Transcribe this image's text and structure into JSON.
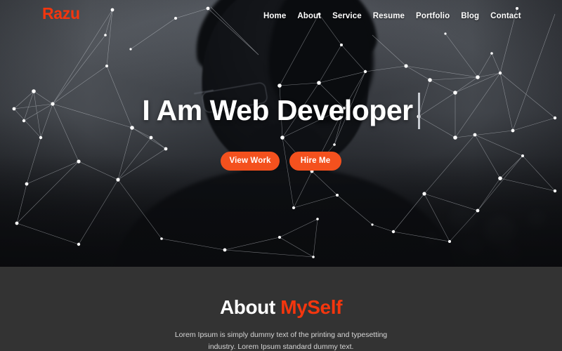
{
  "brand": {
    "logo_text": "Razu",
    "accent_color": "#f4360e",
    "button_color": "#f4511e"
  },
  "nav": {
    "items": [
      {
        "label": "Home"
      },
      {
        "label": "About"
      },
      {
        "label": "Service"
      },
      {
        "label": "Resume"
      },
      {
        "label": "Portfolio"
      },
      {
        "label": "Blog"
      },
      {
        "label": "Contact"
      }
    ]
  },
  "hero": {
    "title": "I Am Web Developer",
    "buttons": {
      "view_work": "View Work",
      "hire_me": "Hire Me"
    },
    "background_color": "#3d4046"
  },
  "about": {
    "title_white": "About ",
    "title_accent": "MySelf",
    "paragraph": "Lorem Ipsum is simply dummy text of the printing and typesetting industry. Lorem Ipsum standard dummy text.",
    "background_color": "#333333"
  }
}
